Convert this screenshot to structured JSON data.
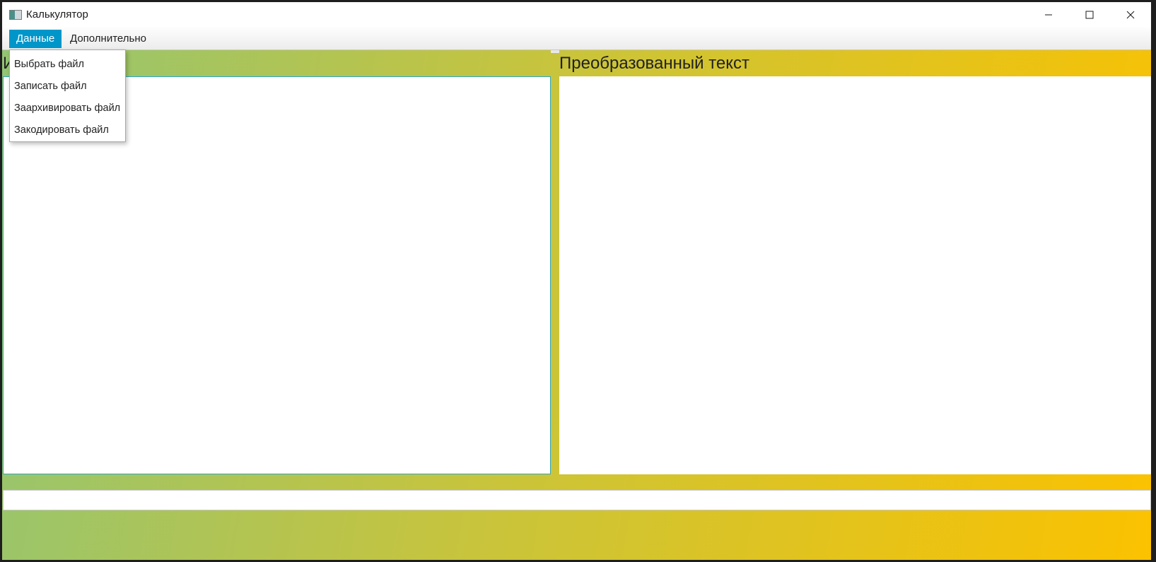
{
  "window": {
    "title": "Калькулятор",
    "icon": "app-window-icon"
  },
  "titlebar_buttons": {
    "minimize": "minimize-icon",
    "maximize": "maximize-icon",
    "close": "close-icon"
  },
  "menu": {
    "items": [
      {
        "label": "Данные",
        "active": true
      },
      {
        "label": "Дополнительно",
        "active": false
      }
    ]
  },
  "dropdown": {
    "items": [
      {
        "label": "Выбрать файл"
      },
      {
        "label": "Записать файл"
      },
      {
        "label": "Заархивировать файл"
      },
      {
        "label": "Закодировать файл"
      }
    ]
  },
  "panels": {
    "left": {
      "title": "И",
      "value": ""
    },
    "right": {
      "title": "Преобразованный текст",
      "value": ""
    }
  },
  "status": {
    "value": ""
  },
  "colors": {
    "accent": "#0096c9",
    "gradient_start": "#93c572",
    "gradient_end": "#fbc200"
  }
}
